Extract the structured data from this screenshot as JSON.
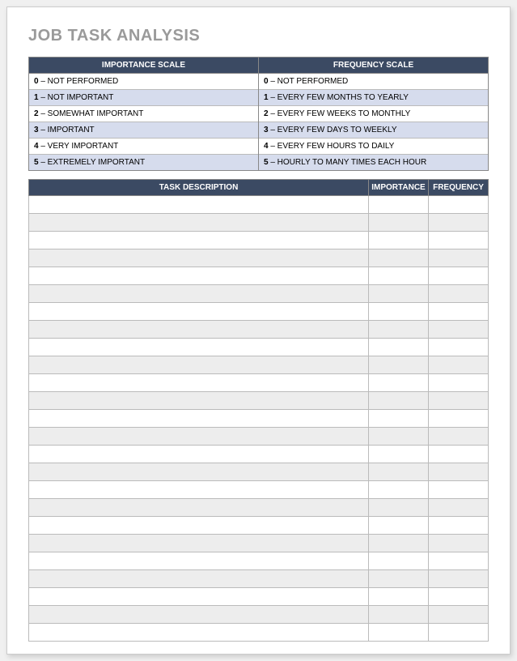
{
  "title": "JOB TASK ANALYSIS",
  "scales": {
    "importance": {
      "header": "IMPORTANCE SCALE",
      "rows": [
        {
          "num": "0",
          "label": " – NOT PERFORMED"
        },
        {
          "num": "1",
          "label": " – NOT IMPORTANT"
        },
        {
          "num": "2",
          "label": " – SOMEWHAT IMPORTANT"
        },
        {
          "num": "3",
          "label": " – IMPORTANT"
        },
        {
          "num": "4",
          "label": " – VERY IMPORTANT"
        },
        {
          "num": "5",
          "label": " – EXTREMELY IMPORTANT"
        }
      ]
    },
    "frequency": {
      "header": "FREQUENCY SCALE",
      "rows": [
        {
          "num": "0",
          "label": " – NOT PERFORMED"
        },
        {
          "num": "1",
          "label": " – EVERY FEW MONTHS TO YEARLY"
        },
        {
          "num": "2",
          "label": " – EVERY FEW WEEKS TO MONTHLY"
        },
        {
          "num": "3",
          "label": " – EVERY FEW DAYS TO WEEKLY"
        },
        {
          "num": "4",
          "label": " – EVERY FEW HOURS TO DAILY"
        },
        {
          "num": "5",
          "label": " – HOURLY TO MANY TIMES EACH HOUR"
        }
      ]
    }
  },
  "task_table": {
    "headers": {
      "description": "TASK DESCRIPTION",
      "importance": "IMPORTANCE",
      "frequency": "FREQUENCY"
    },
    "row_count": 25
  }
}
